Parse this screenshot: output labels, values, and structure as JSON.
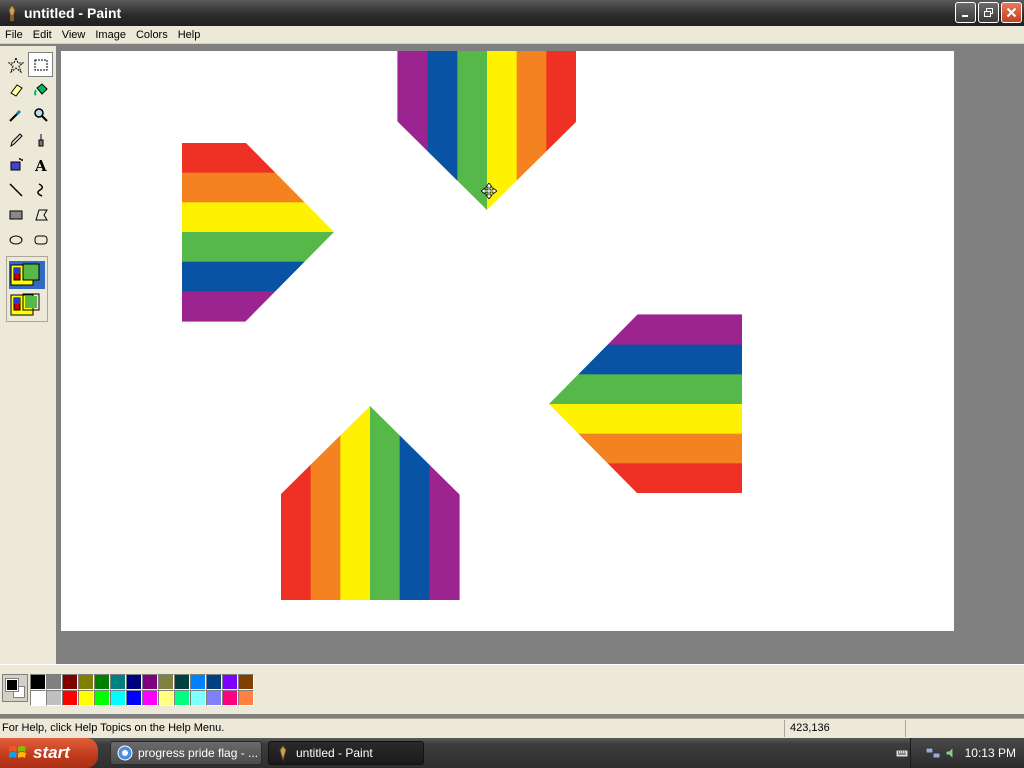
{
  "window": {
    "title": "untitled - Paint"
  },
  "menu": [
    "File",
    "Edit",
    "View",
    "Image",
    "Colors",
    "Help"
  ],
  "tools": [
    {
      "name": "free-form-select-tool",
      "icon": "star-select-icon",
      "active": false
    },
    {
      "name": "select-tool",
      "icon": "rect-select-icon",
      "active": true
    },
    {
      "name": "eraser-tool",
      "icon": "eraser-icon",
      "active": false
    },
    {
      "name": "fill-tool",
      "icon": "paint-bucket-icon",
      "active": false
    },
    {
      "name": "pick-color-tool",
      "icon": "eyedropper-icon",
      "active": false
    },
    {
      "name": "magnifier-tool",
      "icon": "magnifier-icon",
      "active": false
    },
    {
      "name": "pencil-tool",
      "icon": "pencil-icon",
      "active": false
    },
    {
      "name": "brush-tool",
      "icon": "brush-icon",
      "active": false
    },
    {
      "name": "airbrush-tool",
      "icon": "airbrush-icon",
      "active": false
    },
    {
      "name": "text-tool",
      "icon": "text-icon",
      "active": false
    },
    {
      "name": "line-tool",
      "icon": "line-icon",
      "active": false
    },
    {
      "name": "curve-tool",
      "icon": "curve-icon",
      "active": false
    },
    {
      "name": "rectangle-tool",
      "icon": "rectangle-icon",
      "active": false
    },
    {
      "name": "polygon-tool",
      "icon": "polygon-icon",
      "active": false
    },
    {
      "name": "ellipse-tool",
      "icon": "ellipse-icon",
      "active": false
    },
    {
      "name": "rounded-rectangle-tool",
      "icon": "rounded-rect-icon",
      "active": false
    }
  ],
  "palette": [
    "#000000",
    "#808080",
    "#800000",
    "#808000",
    "#008000",
    "#008080",
    "#000080",
    "#800080",
    "#808040",
    "#004040",
    "#0080ff",
    "#004080",
    "#8000ff",
    "#804000",
    "#ffffff",
    "#c0c0c0",
    "#ff0000",
    "#ffff00",
    "#00ff00",
    "#00ffff",
    "#0000ff",
    "#ff00ff",
    "#ffff80",
    "#00ff80",
    "#80ffff",
    "#8080ff",
    "#ff0080",
    "#ff8040"
  ],
  "colors": {
    "foreground": "#000000",
    "background": "#ffffff"
  },
  "artwork": {
    "rainbow": [
      "#ee3124",
      "#f58220",
      "#fff200",
      "#55b848",
      "#0853a3",
      "#9b2490"
    ],
    "chevron": [
      "#000000",
      "#5b3611",
      "#7ebfe8",
      "#f39cc2",
      "#ffffff"
    ]
  },
  "status": {
    "help": "For Help, click Help Topics on the Help Menu.",
    "coords": "423,136"
  },
  "taskbar": {
    "start": "start",
    "tasks": [
      {
        "label": "progress pride flag - ...",
        "icon": "browser-icon"
      },
      {
        "label": "untitled - Paint",
        "icon": "paint-icon"
      }
    ],
    "clock": "10:13 PM"
  }
}
